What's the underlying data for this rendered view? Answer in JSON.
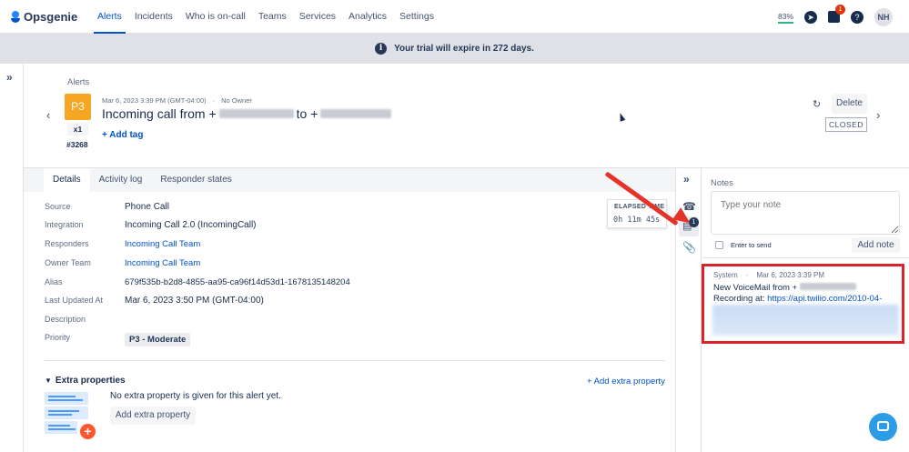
{
  "nav": {
    "logo": "Opsgenie",
    "items": [
      "Alerts",
      "Incidents",
      "Who is on-call",
      "Teams",
      "Services",
      "Analytics",
      "Settings"
    ],
    "usage": "83%",
    "notif_count": "1",
    "user_initials": "NH"
  },
  "banner": {
    "text": "Your trial will expire in 272 days."
  },
  "alert": {
    "breadcrumb": "Alerts",
    "priority": "P3",
    "count": "x1",
    "tiny_id": "#3268",
    "datetime": "Mar 6, 2023 3:39 PM (GMT-04:00)",
    "owner": "No Owner",
    "title_from": "Incoming call from +",
    "title_to": "to +",
    "add_tag": "+ Add tag",
    "delete_label": "Delete",
    "status": "CLOSED"
  },
  "tabs": [
    "Details",
    "Activity log",
    "Responder states"
  ],
  "details": [
    {
      "label": "Source",
      "value": "Phone Call"
    },
    {
      "label": "Integration",
      "value": "Incoming Call 2.0 (IncomingCall)"
    },
    {
      "label": "Responders",
      "value": "Incoming Call Team"
    },
    {
      "label": "Owner Team",
      "value": "Incoming Call Team"
    },
    {
      "label": "Alias",
      "value": "679f535b-b2d8-4855-aa95-ca96f14d53d1-1678135148204"
    },
    {
      "label": "Last Updated At",
      "value": "Mar 6, 2023 3:50 PM (GMT-04:00)"
    },
    {
      "label": "Description",
      "value": ""
    },
    {
      "label": "Priority",
      "value": "P3 - Moderate"
    }
  ],
  "elapsed": {
    "label": "ELAPSED TIME",
    "value": "0h 11m  45s"
  },
  "extra": {
    "heading": "Extra properties",
    "add_link": "+ Add extra property",
    "empty_text": "No extra property is given for this alert yet.",
    "add_button": "Add extra property"
  },
  "rail": {
    "notes_badge": "1"
  },
  "notes": {
    "heading": "Notes",
    "placeholder": "Type your note",
    "enter_label": "Enter to send",
    "add_button": "Add note",
    "entry": {
      "author": "System",
      "datetime": "Mar 6, 2023 3:39 PM",
      "text_start": "New VoiceMail from +",
      "text_end": "Recording at:",
      "link": "https://api.twilio.com/2010-04-"
    }
  },
  "colors": {
    "accent": "#0052cc",
    "priority_p3": "#f6a623",
    "annotation_red": "#e5332a",
    "chat": "#2d9ce6"
  }
}
